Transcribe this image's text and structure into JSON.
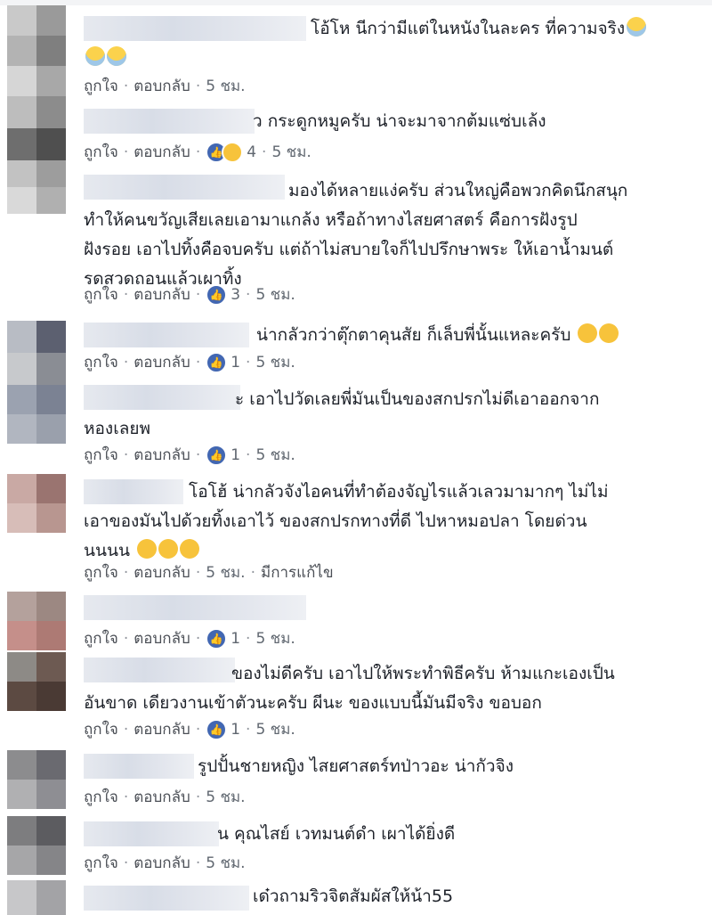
{
  "labels": {
    "like": "ถูกใจ",
    "reply": "ตอบกลับ",
    "edited": "มีการแก้ไข"
  },
  "comments": [
    {
      "text": "โอ้โห นีกว่ามีแต่ในหนังในละคร ที่ความจริง",
      "time": "5 ชม.",
      "reactions": ""
    },
    {
      "text": "ว กระดูกหมูครับ น่าจะมาจากต้มแซ่บเล้ง",
      "time": "5 ชม.",
      "reactions": "4"
    },
    {
      "text": "มองได้หลายแง่ครับ ส่วนใหญ่คือพวกคิดนึกสนุก\nทำให้คนขวัญเสียเลยเอามาแกล้ง หรือถ้าทางไสยศาสตร์ คือการฝังรูป\nฝังรอย เอาไปทิ้งคือจบครับ แต่ถ้าไม่สบายใจก็ไปปรึกษาพระ ให้เอาน้ำมนต์\nรดสวดถอนแล้วเผาทิ้ง",
      "time": "5 ชม.",
      "reactions": "3"
    },
    {
      "text": "น่ากลัวกว่าตุ๊กตาคุนสัย ก็เล็บพี่นั้นแหละครับ",
      "time": "5 ชม.",
      "reactions": "1"
    },
    {
      "text": "ะ เอาไปวัดเลยพี่มันเป็นของสกปรกไม่ดีเอาออกจาก\nหองเลยพ",
      "time": "5 ชม.",
      "reactions": "1"
    },
    {
      "text": "โอโฮ้ น่ากลัวจังไอคนที่ทำต้องจัญไรแล้วเลวมามากๆ ไม่ไม่\nเอาของมันไปด้วยทิ้งเอาไว้ ของสกปรกทางที่ดี ไปหาหมอปลา โดยด่วน\nนนนน",
      "time": "5 ชม.",
      "reactions": ""
    },
    {
      "text": "",
      "time": "5 ชม.",
      "reactions": "1"
    },
    {
      "text": "ของไม่ดีครับ เอาไปให้พระทำพิธีครับ ห้ามแกะเองเป็น\nอันขาด เดียวงานเข้าตัวนะครับ ผีนะ ของแบบนี้มันมีจริง ขอบอก",
      "time": "5 ชม.",
      "reactions": "1"
    },
    {
      "text": "รูปปั้นชายหญิง ไสยศาสตร์ทป่าวอะ น่ากัวจิง",
      "time": "5 ชม.",
      "reactions": ""
    },
    {
      "text": "น คุณไสย์ เวทมนต์ดำ เผาได้ยิ่งดี",
      "time": "5 ชม.",
      "reactions": ""
    },
    {
      "text": "เด๋วถามริวจิตสัมผัสให้น้า55",
      "time": "",
      "reactions": ""
    }
  ]
}
